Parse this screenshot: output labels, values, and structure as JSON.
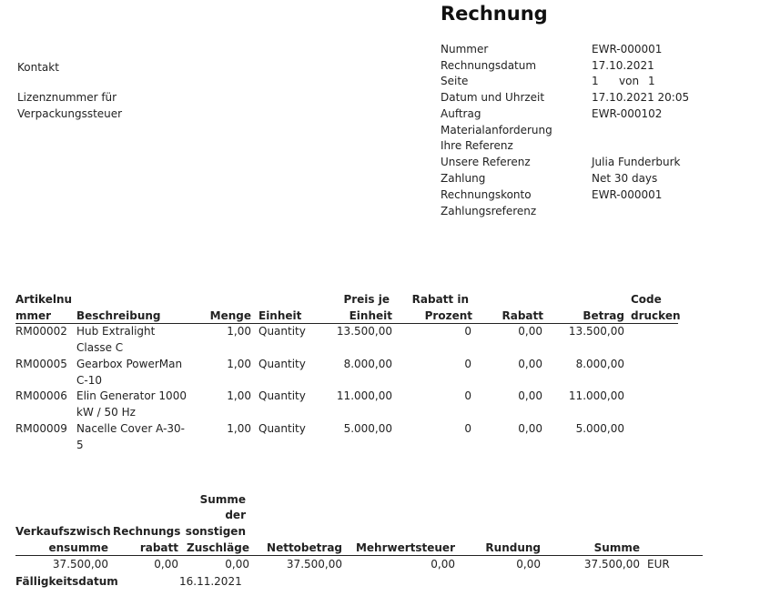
{
  "document": {
    "title": "Rechnung"
  },
  "left_labels": {
    "contact": "Kontakt",
    "license_line1": "Lizenznummer für",
    "license_line2": "Verpackungssteuer"
  },
  "header_fields": [
    {
      "label": "Nummer",
      "value": "EWR-000001"
    },
    {
      "label": "Rechnungsdatum",
      "value": "17.10.2021"
    },
    {
      "label": "Seite",
      "value": "1",
      "value2": "von",
      "value3": "1"
    },
    {
      "label": "Datum und Uhrzeit",
      "value": "17.10.2021 20:05"
    },
    {
      "label": "Auftrag",
      "value": "EWR-000102"
    },
    {
      "label": "Materialanforderung",
      "value": ""
    },
    {
      "label": "Ihre Referenz",
      "value": ""
    },
    {
      "label": "Unsere Referenz",
      "value": "Julia Funderburk"
    },
    {
      "label": "Zahlung",
      "value": "Net 30 days"
    },
    {
      "label": "Rechnungskonto",
      "value": "EWR-000001"
    },
    {
      "label": "Zahlungsreferenz",
      "value": ""
    }
  ],
  "lines_table": {
    "headers": {
      "item_l1": "Artikelnu",
      "item_l2": "mmer",
      "description": "Beschreibung",
      "qty": "Menge",
      "unit": "Einheit",
      "price_l1": "Preis je",
      "price_l2": "Einheit",
      "discpct_l1": "Rabatt in",
      "discpct_l2": "Prozent",
      "discount": "Rabatt",
      "amount": "Betrag",
      "code_l1": "Code",
      "code_l2": "drucken"
    },
    "rows": [
      {
        "item": "RM00002",
        "desc1": "Hub Extralight",
        "desc2": "Classe C",
        "qty": "1,00",
        "unit": "Quantity",
        "price": "13.500,00",
        "discpct": "0",
        "discount": "0,00",
        "amount": "13.500,00"
      },
      {
        "item": "RM00005",
        "desc1": "Gearbox PowerMan",
        "desc2": "C-10",
        "qty": "1,00",
        "unit": "Quantity",
        "price": "8.000,00",
        "discpct": "0",
        "discount": "0,00",
        "amount": "8.000,00"
      },
      {
        "item": "RM00006",
        "desc1": "Elin Generator 1000",
        "desc2": "kW / 50 Hz",
        "qty": "1,00",
        "unit": "Quantity",
        "price": "11.000,00",
        "discpct": "0",
        "discount": "0,00",
        "amount": "11.000,00"
      },
      {
        "item": "RM00009",
        "desc1": "Nacelle Cover A-30-",
        "desc2": "5",
        "qty": "1,00",
        "unit": "Quantity",
        "price": "5.000,00",
        "discpct": "0",
        "discount": "0,00",
        "amount": "5.000,00"
      }
    ]
  },
  "totals": {
    "headers": {
      "subtotal_l1": "Verkaufszwisch",
      "subtotal_l2": "ensumme",
      "invdisc_l1": "Rechnungs",
      "invdisc_l2": "rabatt",
      "other_l1": "Summe",
      "other_l2": "der",
      "other_l3": "sonstigen",
      "other_l4": "Zuschläge",
      "net": "Nettobetrag",
      "vat": "Mehrwertsteuer",
      "rounding": "Rundung",
      "total": "Summe"
    },
    "values": {
      "subtotal": "37.500,00",
      "invdisc": "0,00",
      "other": "0,00",
      "net": "37.500,00",
      "vat": "0,00",
      "rounding": "0,00",
      "total": "37.500,00",
      "currency": "EUR"
    },
    "due_label": "Fälligkeitsdatum",
    "due_value": "16.11.2021"
  }
}
